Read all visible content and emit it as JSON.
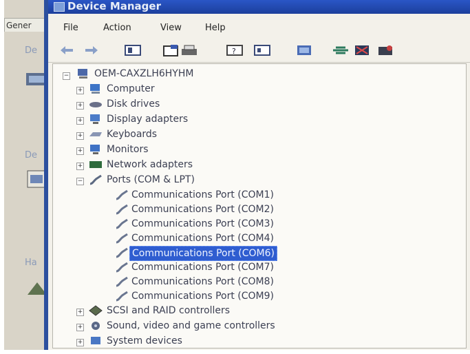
{
  "window": {
    "title": "Device Manager"
  },
  "background_dialog": {
    "tab_label": "Gener",
    "labels": [
      "De",
      "De",
      "Ha"
    ]
  },
  "menu": [
    "File",
    "Action",
    "View",
    "Help"
  ],
  "toolbar": {
    "buttons": [
      "back-arrow-icon",
      "forward-arrow-icon",
      "show-hide-console-tree-icon",
      "properties-icon",
      "print-icon",
      "help-icon",
      "view-icon",
      "scan-hardware-icon",
      "update-driver-icon",
      "disable-device-icon",
      "uninstall-device-icon"
    ]
  },
  "tree": {
    "root": "OEM-CAXZLH6HYHM",
    "categories": [
      {
        "label": "Computer",
        "icon": "computer-icon"
      },
      {
        "label": "Disk drives",
        "icon": "disk-drive-icon"
      },
      {
        "label": "Display adapters",
        "icon": "display-adapter-icon"
      },
      {
        "label": "Keyboards",
        "icon": "keyboard-icon"
      },
      {
        "label": "Monitors",
        "icon": "monitor-icon"
      },
      {
        "label": "Network adapters",
        "icon": "network-adapter-icon"
      },
      {
        "label": "Ports (COM & LPT)",
        "icon": "port-icon",
        "expanded": true
      }
    ],
    "ports": [
      "Communications Port (COM1)",
      "Communications Port (COM2)",
      "Communications Port (COM3)",
      "Communications Port (COM4)",
      "Communications Port (COM6)",
      "Communications Port (COM7)",
      "Communications Port (COM8)",
      "Communications Port (COM9)"
    ],
    "selected_port": "Communications Port (COM6)",
    "categories_after": [
      {
        "label": "SCSI and RAID controllers",
        "icon": "scsi-controller-icon"
      },
      {
        "label": "Sound, video and game controllers",
        "icon": "sound-controller-icon"
      },
      {
        "label": "System devices",
        "icon": "system-device-icon"
      }
    ]
  }
}
